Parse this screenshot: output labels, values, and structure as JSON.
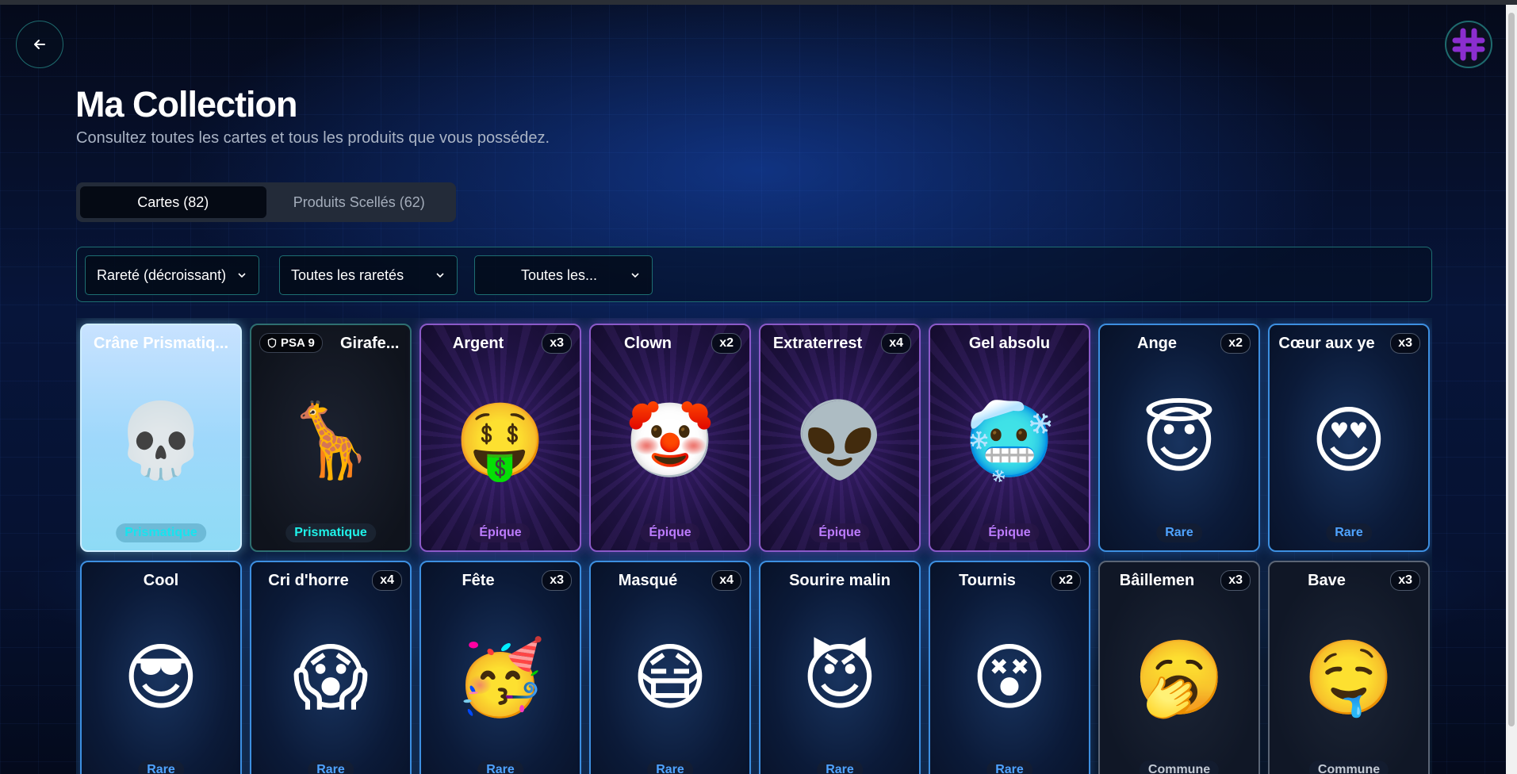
{
  "header": {
    "title": "Ma Collection",
    "subtitle": "Consultez toutes les cartes et tous les produits que vous possédez."
  },
  "tabs": [
    {
      "label": "Cartes (82)",
      "active": true
    },
    {
      "label": "Produits Scellés (62)",
      "active": false
    }
  ],
  "filters": {
    "sort": "Rareté (décroissant)",
    "rarity": "Toutes les raretés",
    "other": "Toutes les..."
  },
  "cards": [
    {
      "name": "Crâne Prismatiq...",
      "emoji": "💀",
      "rarity": "Prismatique",
      "style": "prism-light",
      "count": ""
    },
    {
      "name": "Girafe...",
      "emoji": "🦒",
      "rarity": "Prismatique",
      "style": "prism-dark",
      "count": "",
      "psa": "PSA 9"
    },
    {
      "name": "Argent",
      "emoji": "🤑",
      "rarity": "Épique",
      "style": "epic",
      "count": "x3"
    },
    {
      "name": "Clown",
      "emoji": "🤡",
      "rarity": "Épique",
      "style": "epic",
      "count": "x2"
    },
    {
      "name": "Extraterrest",
      "emoji": "👽",
      "rarity": "Épique",
      "style": "epic",
      "count": "x4"
    },
    {
      "name": "Gel absolu",
      "emoji": "🥶",
      "rarity": "Épique",
      "style": "epic",
      "count": ""
    },
    {
      "name": "Ange",
      "emoji": "😇",
      "rarity": "Rare",
      "style": "rare",
      "count": "x2"
    },
    {
      "name": "Cœur aux ye",
      "emoji": "😍",
      "rarity": "Rare",
      "style": "rare",
      "count": "x3"
    },
    {
      "name": "Cool",
      "emoji": "😎",
      "rarity": "Rare",
      "style": "rare",
      "count": ""
    },
    {
      "name": "Cri d'horre",
      "emoji": "😱",
      "rarity": "Rare",
      "style": "rare",
      "count": "x4"
    },
    {
      "name": "Fête",
      "emoji": "🥳",
      "rarity": "Rare",
      "style": "rare",
      "count": "x3"
    },
    {
      "name": "Masqué",
      "emoji": "😷",
      "rarity": "Rare",
      "style": "rare",
      "count": "x4"
    },
    {
      "name": "Sourire malin",
      "emoji": "😈",
      "rarity": "Rare",
      "style": "rare",
      "count": ""
    },
    {
      "name": "Tournis",
      "emoji": "😵",
      "rarity": "Rare",
      "style": "rare",
      "count": "x2"
    },
    {
      "name": "Bâillemen",
      "emoji": "🥱",
      "rarity": "Commune",
      "style": "commune",
      "count": "x3"
    },
    {
      "name": "Bave",
      "emoji": "🤤",
      "rarity": "Commune",
      "style": "commune",
      "count": "x3"
    }
  ]
}
